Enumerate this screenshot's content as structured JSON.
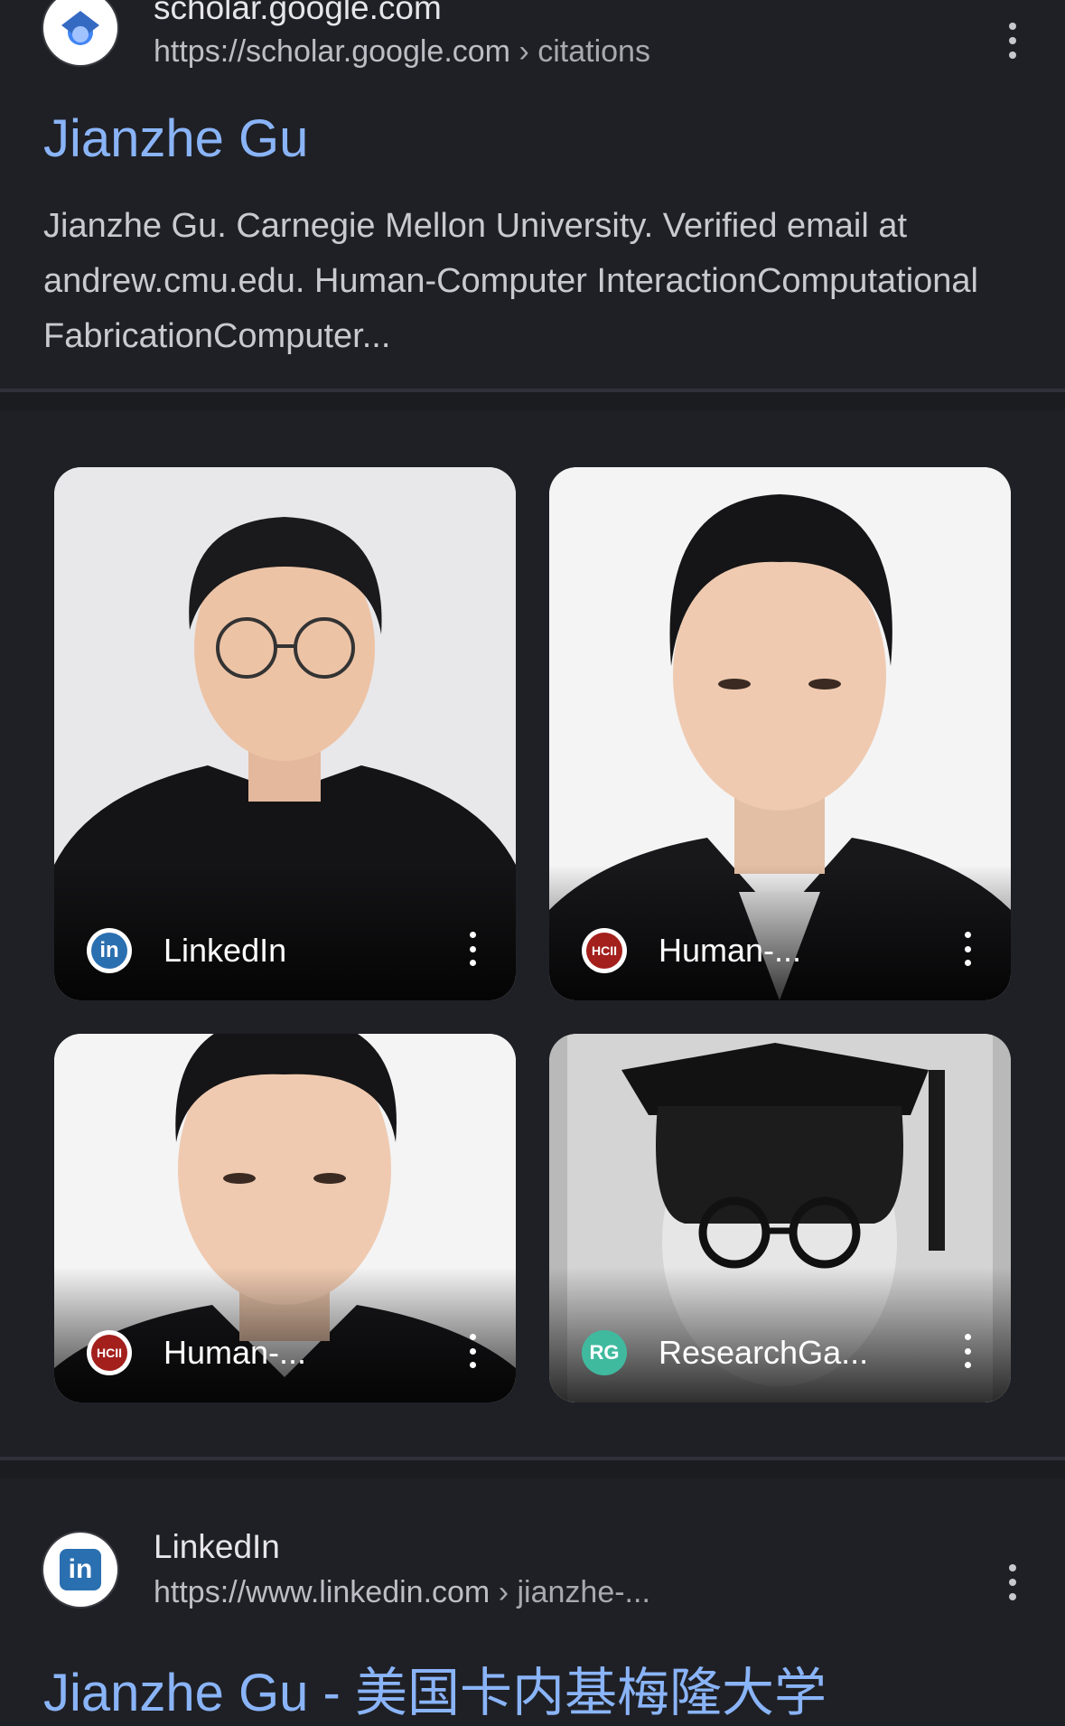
{
  "result1": {
    "site_name": "scholar.google.com",
    "url_base": "https://scholar.google.com",
    "url_path": " › citations",
    "favicon": "google-scholar-icon",
    "title": "Jianzhe Gu",
    "snippet": "Jianzhe Gu. Carnegie Mellon University. Verified email at andrew.cmu.edu. Human-Computer InteractionComputational FabricationComputer..."
  },
  "images": [
    {
      "source": "LinkedIn",
      "icon": "linkedin-icon",
      "icon_text": "in",
      "icon_color": "#2a6fb0"
    },
    {
      "source": "Human-...",
      "icon": "hcii-icon",
      "icon_text": "HCII",
      "icon_color": "#a3201c"
    },
    {
      "source": "Human-...",
      "icon": "hcii-icon",
      "icon_text": "HCII",
      "icon_color": "#a3201c"
    },
    {
      "source": "ResearchGa...",
      "icon": "researchgate-icon",
      "icon_text": "RG",
      "icon_color": "#40ba9f"
    }
  ],
  "result2": {
    "site_name": "LinkedIn",
    "url_base": "https://www.linkedin.com",
    "url_path": " › jianzhe-...",
    "favicon": "linkedin-icon",
    "title_partial": "Jianzhe Gu - 美国卡内基梅隆大学"
  }
}
